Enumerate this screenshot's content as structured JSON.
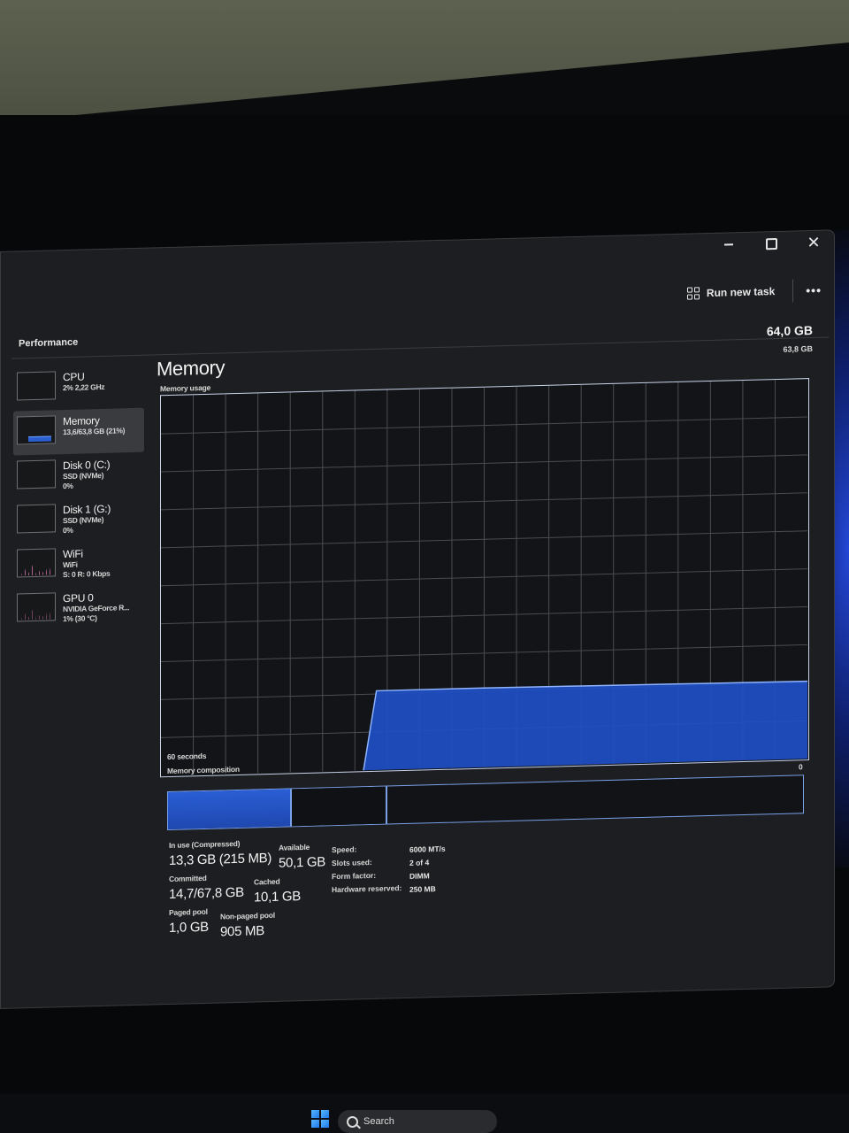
{
  "window": {
    "minimize_label": "–",
    "close_label": "✕"
  },
  "toolbar": {
    "run_new_task": "Run new task",
    "more": "•••"
  },
  "section": {
    "title": "Performance"
  },
  "sidebar": {
    "items": [
      {
        "name": "CPU",
        "sub1": "2% 2,22 GHz",
        "sub2": ""
      },
      {
        "name": "Memory",
        "sub1": "13,6/63,8 GB (21%)",
        "sub2": ""
      },
      {
        "name": "Disk 0 (C:)",
        "sub1": "SSD (NVMe)",
        "sub2": "0%"
      },
      {
        "name": "Disk 1 (G:)",
        "sub1": "SSD (NVMe)",
        "sub2": "0%"
      },
      {
        "name": "WiFi",
        "sub1": "WiFi",
        "sub2": "S: 0 R: 0 Kbps"
      },
      {
        "name": "GPU 0",
        "sub1": "NVIDIA GeForce R...",
        "sub2": "1% (30 °C)"
      }
    ]
  },
  "memory": {
    "title": "Memory",
    "total": "64,0 GB",
    "graph_max": "63,8 GB",
    "usage_label": "Memory usage",
    "time_label": "60 seconds",
    "graph_min": "0",
    "composition_label": "Memory composition",
    "composition": {
      "in_use_fraction": 0.195,
      "modified_fraction": 0.15,
      "standby_fraction": 0.0
    }
  },
  "chart_data": {
    "type": "area",
    "title": "Memory usage",
    "xlabel": "60 seconds",
    "ylim": [
      0,
      63.8
    ],
    "x": [
      60,
      42.5,
      41.2,
      40,
      30,
      20,
      10,
      0
    ],
    "values": [
      null,
      null,
      0,
      13.3,
      13.3,
      13.2,
      13.1,
      13.0
    ],
    "grid": true
  },
  "stats": {
    "in_use_label": "In use (Compressed)",
    "in_use_value": "13,3 GB (215 MB)",
    "available_label": "Available",
    "available_value": "50,1 GB",
    "committed_label": "Committed",
    "committed_value": "14,7/67,8 GB",
    "cached_label": "Cached",
    "cached_value": "10,1 GB",
    "paged_label": "Paged pool",
    "paged_value": "1,0 GB",
    "nonpaged_label": "Non-paged pool",
    "nonpaged_value": "905 MB"
  },
  "specs": {
    "speed_label": "Speed:",
    "speed_value": "6000 MT/s",
    "slots_label": "Slots used:",
    "slots_value": "2 of 4",
    "form_label": "Form factor:",
    "form_value": "DIMM",
    "hw_label": "Hardware reserved:",
    "hw_value": "250 MB"
  },
  "taskbar": {
    "search": "Search"
  },
  "colors": {
    "accent": "#2b5fcf",
    "graph_border": "#c9d4ea",
    "background": "#1d1e21"
  }
}
